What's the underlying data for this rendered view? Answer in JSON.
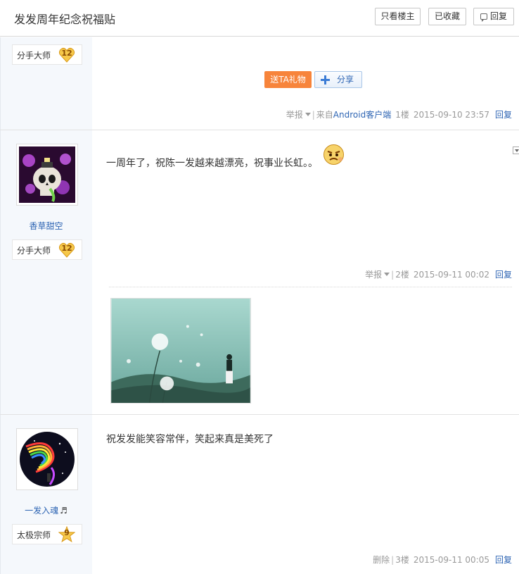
{
  "header": {
    "title": "发发周年纪念祝福贴",
    "only_op_label": "只看楼主",
    "favorited_label": "已收藏",
    "reply_label": "回复"
  },
  "post1": {
    "level": {
      "name": "分手大师",
      "num": "12"
    },
    "gift_label": "送TA礼物",
    "share_label": "分享",
    "meta": {
      "report": "举报",
      "from_prefix": "来自",
      "client": "Android客户端",
      "floor": "1楼",
      "time": "2015-09-10 23:57",
      "reply": "回复"
    }
  },
  "post2": {
    "username": "香草甜空",
    "level": {
      "name": "分手大师",
      "num": "12"
    },
    "text": "一周年了，祝陈一发越来越漂亮，祝事业长虹。。",
    "meta": {
      "report": "举报",
      "floor": "2楼",
      "time": "2015-09-11 00:02",
      "reply": "回复"
    }
  },
  "post3": {
    "username": "一发入魂",
    "username_icon": "♬",
    "level": {
      "name": "太极宗师",
      "num": "9"
    },
    "text": "祝发发能笑容常伴，笑起来真是美死了",
    "meta": {
      "delete": "删除",
      "floor": "3楼",
      "time": "2015-09-11 00:05",
      "reply": "回复"
    }
  },
  "colors": {
    "accent": "#2d64b3",
    "gift": "#f7843b",
    "sidebar_bg": "#f5f8fc"
  }
}
